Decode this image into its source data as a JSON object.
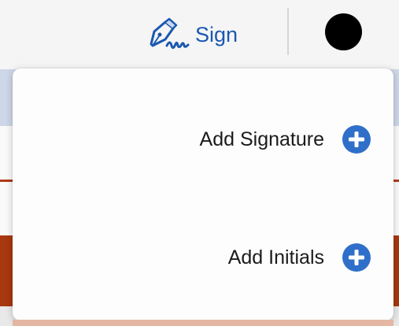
{
  "toolbar": {
    "sign_label": "Sign",
    "sign_icon": "pen-signature-icon",
    "avatar_color": "#000000"
  },
  "menu": {
    "items": [
      {
        "label": "Add Signature",
        "icon": "plus-circle-icon"
      },
      {
        "label": "Add Initials",
        "icon": "plus-circle-icon"
      }
    ]
  },
  "colors": {
    "accent": "#1a58b0",
    "plus_icon": "#2f6fc9",
    "background_red": "#a8380f"
  }
}
